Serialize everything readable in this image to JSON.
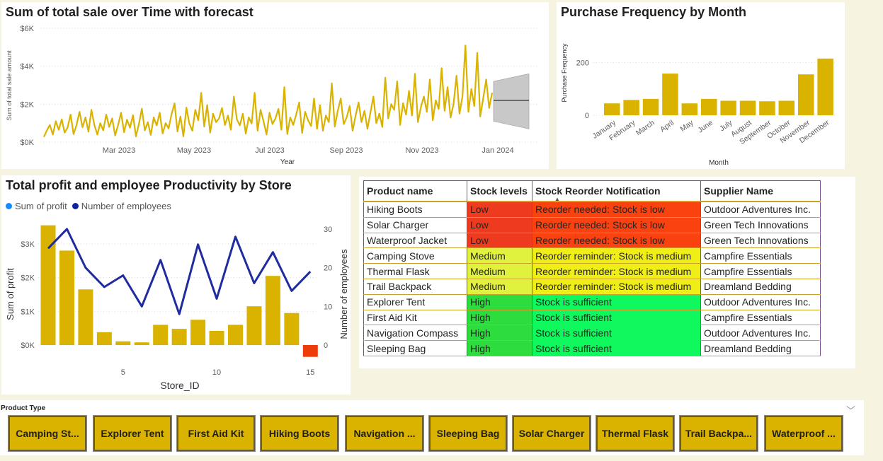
{
  "sales": {
    "title": "Sum of total sale over Time with forecast",
    "ylabel": "Sum of total sale amount",
    "xlabel": "Year",
    "yticks": [
      "$0K",
      "$2K",
      "$4K",
      "$6K"
    ],
    "xticks": [
      "Mar 2023",
      "May 2023",
      "Jul 2023",
      "Sep 2023",
      "Nov 2023",
      "Jan 2024"
    ],
    "line_color": "#d9b300",
    "forecast_color": "#c8c8c8"
  },
  "freq": {
    "title": "Purchase Frequency by Month",
    "ylabel": "Purchase Frequency",
    "xlabel": "Month",
    "yticks": [
      "0",
      "200"
    ],
    "bar_color": "#d9b300"
  },
  "combo": {
    "title": "Total profit and employee Productivity by Store",
    "legend": [
      {
        "label": "Sum of profit",
        "color": "#118dff"
      },
      {
        "label": "Number of employees",
        "color": "#12239e"
      }
    ],
    "ylabel_left": "Sum of profit",
    "ylabel_right": "Number of employees",
    "xlabel": "Store_ID",
    "yticks_left": [
      "$0K",
      "$1K",
      "$2K",
      "$3K"
    ],
    "yticks_right": [
      "0",
      "10",
      "20",
      "30"
    ],
    "xticks": [
      "5",
      "10",
      "15"
    ]
  },
  "table": {
    "headers": [
      "Product name",
      "Stock levels",
      "Stock Reorder Notification",
      "Supplier Name"
    ],
    "rows": [
      {
        "product": "Hiking Boots",
        "level": "Low",
        "note": "Reorder needed: Stock is low",
        "supplier": "Outdoor Adventures Inc."
      },
      {
        "product": "Solar Charger",
        "level": "Low",
        "note": "Reorder needed: Stock is low",
        "supplier": "Green Tech Innovations"
      },
      {
        "product": "Waterproof Jacket",
        "level": "Low",
        "note": "Reorder needed: Stock is low",
        "supplier": "Green Tech Innovations"
      },
      {
        "product": "Camping Stove",
        "level": "Medium",
        "note": "Reorder reminder: Stock is medium",
        "supplier": "Campfire Essentials"
      },
      {
        "product": "Thermal Flask",
        "level": "Medium",
        "note": "Reorder reminder: Stock is medium",
        "supplier": "Campfire Essentials"
      },
      {
        "product": "Trail Backpack",
        "level": "Medium",
        "note": "Reorder reminder: Stock is medium",
        "supplier": "Dreamland Bedding"
      },
      {
        "product": "Explorer Tent",
        "level": "High",
        "note": "Stock is sufficient",
        "supplier": "Outdoor Adventures Inc."
      },
      {
        "product": "First Aid Kit",
        "level": "High",
        "note": "Stock is sufficient",
        "supplier": "Campfire Essentials"
      },
      {
        "product": "Navigation Compass",
        "level": "High",
        "note": "Stock is sufficient",
        "supplier": "Outdoor Adventures Inc."
      },
      {
        "product": "Sleeping Bag",
        "level": "High",
        "note": "Stock is sufficient",
        "supplier": "Dreamland Bedding"
      }
    ],
    "level_colors": {
      "Low": {
        "level": "#ee3b1f",
        "note": "#f9420f"
      },
      "Medium": {
        "level": "#e1f23e",
        "note": "#f0ee17"
      },
      "High": {
        "level": "#2ddc3d",
        "note": "#0ff95f"
      }
    }
  },
  "slicer": {
    "label": "Product Type",
    "chips": [
      "Camping St...",
      "Explorer Tent",
      "First Aid Kit",
      "Hiking Boots",
      "Navigation ...",
      "Sleeping Bag",
      "Solar Charger",
      "Thermal Flask",
      "Trail Backpa...",
      "Waterproof ..."
    ]
  },
  "chart_data": [
    {
      "type": "line",
      "title": "Sum of total sale over Time with forecast",
      "xlabel": "Year",
      "ylabel": "Sum of total sale amount",
      "ylim": [
        0,
        6000
      ],
      "x_range": [
        "2023-01-01",
        "2024-01-31"
      ],
      "series": [
        {
          "values": [
            280,
            620,
            900,
            400,
            1100,
            650,
            1200,
            500,
            780,
            1450,
            420,
            900,
            1600,
            780,
            1300,
            550,
            1700,
            900,
            400,
            1000,
            620,
            1450,
            800,
            1250,
            350,
            900,
            1550,
            520,
            1180,
            760,
            1420,
            300,
            950,
            1760,
            620,
            1050,
            380,
            1300,
            880,
            1550,
            460,
            1000,
            720,
            1480,
            2050,
            560,
            1350,
            300,
            1820,
            980,
            600,
            1700,
            1150,
            2600,
            820,
            1950,
            500,
            1500,
            1050,
            1250,
            1800,
            900,
            1400,
            650,
            2400,
            1200,
            880,
            1500,
            450,
            1300,
            980,
            2600,
            600,
            1700,
            1100,
            400,
            1550,
            950,
            1250,
            1750,
            650,
            2900,
            420,
            1300,
            900,
            1450,
            2100,
            480,
            1600,
            1150,
            850,
            2300,
            700,
            1950,
            600,
            1400,
            1050,
            3100,
            820,
            1650,
            2300,
            950,
            1300,
            1900,
            600,
            1400,
            2100,
            1050,
            1650,
            700,
            1550,
            2400,
            1000,
            1500,
            800,
            3400,
            1250,
            2000,
            1700,
            3200,
            900,
            2050,
            1450,
            2700,
            1400,
            3600,
            1050,
            1850,
            2400,
            1600,
            3300,
            1150,
            2200,
            1750,
            3900,
            1650,
            2900,
            1300,
            2000,
            3500,
            1500,
            2400,
            5100,
            1600,
            2800,
            1900,
            4700,
            1350,
            2300,
            3300,
            1800,
            2600
          ],
          "color": "#d9b300"
        },
        {
          "name": "forecast",
          "values": [
            2200,
            2200
          ],
          "upper": [
            3200,
            3600
          ],
          "lower": [
            1100,
            700
          ]
        }
      ]
    },
    {
      "type": "bar",
      "title": "Purchase Frequency by Month",
      "xlabel": "Month",
      "ylabel": "Purchase Frequency",
      "categories": [
        "January",
        "February",
        "March",
        "April",
        "May",
        "June",
        "July",
        "August",
        "September",
        "October",
        "November",
        "December"
      ],
      "values": [
        45,
        58,
        62,
        158,
        45,
        62,
        55,
        55,
        53,
        55,
        155,
        215
      ],
      "ylim": [
        0,
        240
      ]
    },
    {
      "type": "bar",
      "title": "Total profit and employee Productivity by Store",
      "xlabel": "Store_ID",
      "categories": [
        1,
        2,
        3,
        4,
        5,
        6,
        7,
        8,
        9,
        10,
        11,
        12,
        13,
        14,
        15
      ],
      "series": [
        {
          "name": "Sum of profit",
          "values": [
            3550,
            2800,
            1650,
            380,
            110,
            80,
            600,
            480,
            750,
            420,
            600,
            1150,
            2050,
            950,
            -350
          ]
        },
        {
          "name": "Number of employees",
          "values": [
            25,
            30,
            20,
            15,
            18,
            10,
            22,
            8,
            26,
            12,
            28,
            16,
            24,
            14,
            19
          ]
        }
      ],
      "ylim_left": [
        -400,
        3700
      ],
      "ylim_right": [
        -3,
        33
      ]
    }
  ]
}
